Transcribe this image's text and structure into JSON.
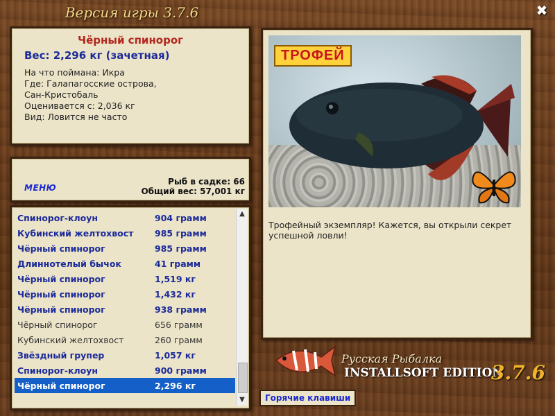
{
  "app": {
    "title": "Версия игры 3.7.6",
    "close_glyph": "✖"
  },
  "info": {
    "fish_name": "Чёрный спинорог",
    "weight": "Вес: 2,296 кг (зачетная)",
    "bait": "На что поймана: Икра",
    "place_1": "Где: Галапагосские острова,",
    "place_2": "Сан-Кристобаль",
    "valued_from": "Оценивается с: 2,036 кг",
    "kind": "Вид: Ловится не часто"
  },
  "menu": {
    "menu_label": "МЕНЮ",
    "fish_in_cage": "Рыб в садке: 66",
    "total_weight": "Общий вес: 57,001 кг"
  },
  "catch_list": [
    {
      "name": "Спинорог-клоун",
      "weight": "904 грамм",
      "style": "bold"
    },
    {
      "name": "Кубинский желтохвост",
      "weight": "985 грамм",
      "style": "bold"
    },
    {
      "name": "Чёрный спинорог",
      "weight": "985 грамм",
      "style": "bold"
    },
    {
      "name": "Длиннотелый бычок",
      "weight": "41 грамм",
      "style": "bold"
    },
    {
      "name": "Чёрный спинорог",
      "weight": "1,519 кг",
      "style": "bold"
    },
    {
      "name": "Чёрный спинорог",
      "weight": "1,432 кг",
      "style": "bold"
    },
    {
      "name": "Чёрный спинорог",
      "weight": "938 грамм",
      "style": "bold"
    },
    {
      "name": "Чёрный спинорог",
      "weight": "656 грамм",
      "style": "norm"
    },
    {
      "name": "Кубинский желтохвост",
      "weight": "260 грамм",
      "style": "norm"
    },
    {
      "name": "Звёздный групер",
      "weight": "1,057 кг",
      "style": "bold"
    },
    {
      "name": "Спинорог-клоун",
      "weight": "900 грамм",
      "style": "bold"
    },
    {
      "name": "Чёрный спинорог",
      "weight": "2,296 кг",
      "style": "sel"
    }
  ],
  "photo": {
    "badge": "ТРОФЕЙ",
    "description": "Трофейный экземпляр! Кажется, вы открыли секрет успешной ловли!"
  },
  "brand": {
    "line1": "Русская Рыбалка",
    "line2": "INSTALLSOFT EDITION",
    "version": "3.7.6"
  },
  "hotkeys_label": "Горячие клавиши",
  "colors": {
    "accent_blue": "#1b2a9a",
    "fish_name_red": "#b3261e",
    "selection": "#1560c8",
    "panel_bg": "#ece4c8"
  }
}
